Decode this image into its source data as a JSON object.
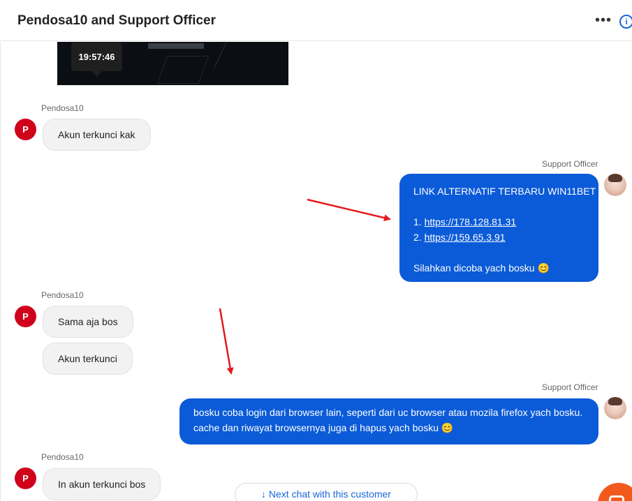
{
  "header": {
    "title": "Pendosa10 and Support Officer",
    "more_icon": "more-horizontal-icon",
    "info_icon": "info-icon",
    "more_glyph": "•••",
    "info_glyph": "i"
  },
  "tooltip": {
    "time": "19:57:46"
  },
  "customer": {
    "name": "Pendosa10",
    "initial": "P"
  },
  "agent": {
    "name": "Support Officer"
  },
  "messages": {
    "m1": "Akun terkunci kak",
    "m2_title": "LINK ALTERNATIF TERBARU WIN11BET :",
    "m2_prefix1": "1. ",
    "m2_link1": "https://178.128.81.31",
    "m2_prefix2": "2. ",
    "m2_link2": "https://159.65.3.91",
    "m2_footer": "Silahkan dicoba yach bosku 😊",
    "m3": "Sama aja bos",
    "m4": "Akun terkunci",
    "m5_line1": "bosku coba login dari browser lain, seperti dari uc browser atau mozila firefox yach bosku.",
    "m5_line2": "cache dan riwayat browsernya juga di hapus yach bosku 😊",
    "m6": "In akun terkunci bos"
  },
  "footer": {
    "next_chat": "↓ Next chat with this customer",
    "launcher_icon": "chat-launcher-icon"
  },
  "colors": {
    "agent_bubble": "#0b5bd8",
    "customer_avatar": "#d0021b",
    "link_accent": "#1a66d6",
    "annotation_arrow": "#e5191d",
    "launcher": "#f25a1d"
  }
}
